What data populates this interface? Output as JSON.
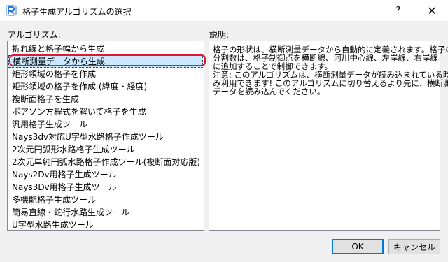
{
  "window": {
    "title": "格子生成アルゴリズムの選択",
    "help_label": "?",
    "close_label": "✕"
  },
  "labels": {
    "algorithm": "アルゴリズム:",
    "description": "説明:"
  },
  "algorithms": [
    {
      "label": "折れ線と格子幅から生成",
      "selected": false
    },
    {
      "label": "横断測量データから生成",
      "selected": true
    },
    {
      "label": "矩形領域の格子を作成",
      "selected": false
    },
    {
      "label": "矩形領域の格子を作成 (緯度・経度)",
      "selected": false
    },
    {
      "label": "複断面格子を生成",
      "selected": false
    },
    {
      "label": "ポアソン方程式を解いて格子を生成",
      "selected": false
    },
    {
      "label": "汎用格子生成ツール",
      "selected": false
    },
    {
      "label": "Nays3dv対応U字型水路格子作成ツール",
      "selected": false
    },
    {
      "label": "2次元円弧形水路格子生成ツール",
      "selected": false
    },
    {
      "label": "2次元単純円弧水路格子作成ツール(複断面対応版)",
      "selected": false
    },
    {
      "label": "Nays2Dv用格子生成ツール",
      "selected": false
    },
    {
      "label": "Nays3Dv用格子生成ツール",
      "selected": false
    },
    {
      "label": "多機能格子生成ツール",
      "selected": false
    },
    {
      "label": "簡易直線・蛇行水路生成ツール",
      "selected": false
    },
    {
      "label": "U字型水路生成ツール",
      "selected": false
    }
  ],
  "description_lines": [
    "格子の形状は、横断測量データから自動的に定義されます。格子の",
    "分割数は、格子制御点を横断線、河川中心線、左岸線、右岸線",
    "に追加することで制御できます。",
    "注意: このアルゴリズムは、横断測量データが読み込まれている時の",
    "み利用できます! このアルゴリズムに切り替えるより先に、横断測量",
    "データを読み込んでください。"
  ],
  "buttons": {
    "ok": "OK",
    "cancel": "キャンセル"
  },
  "colors": {
    "selection": "#cce8ff",
    "highlight_ring": "#e0182d",
    "app_icon": "#2b7bd6"
  }
}
